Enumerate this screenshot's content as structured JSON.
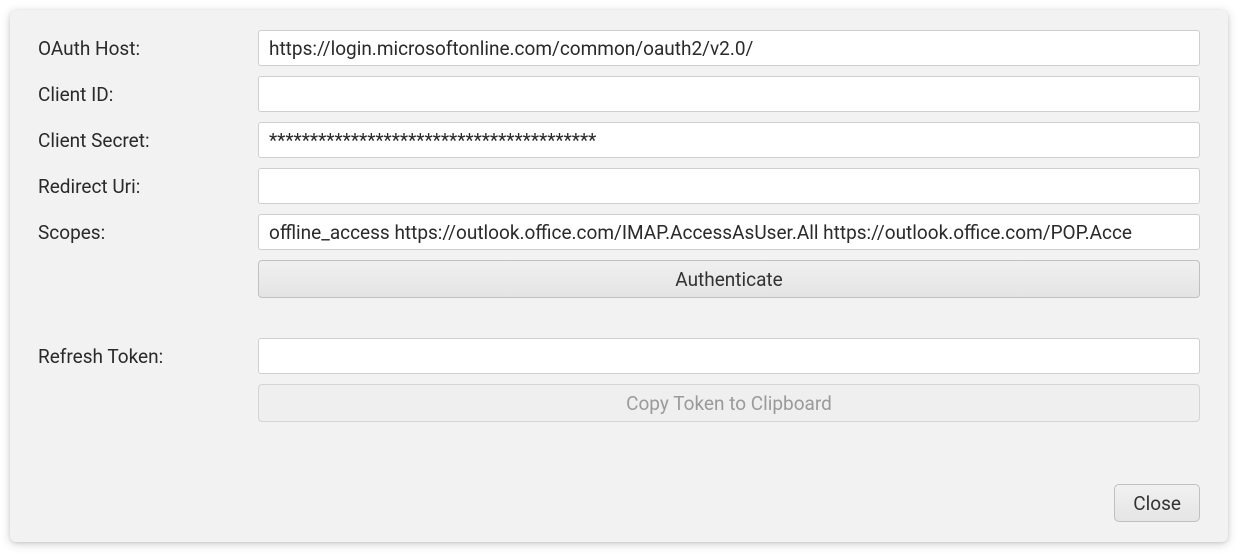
{
  "fields": {
    "oauth_host": {
      "label": "OAuth Host:",
      "value": "https://login.microsoftonline.com/common/oauth2/v2.0/"
    },
    "client_id": {
      "label": "Client ID:",
      "value": ""
    },
    "client_secret": {
      "label": "Client Secret:",
      "value": "****************************************"
    },
    "redirect_uri": {
      "label": "Redirect Uri:",
      "value": ""
    },
    "scopes": {
      "label": "Scopes:",
      "value": "offline_access https://outlook.office.com/IMAP.AccessAsUser.All https://outlook.office.com/POP.Acce"
    },
    "refresh_token": {
      "label": "Refresh Token:",
      "value": ""
    }
  },
  "buttons": {
    "authenticate": "Authenticate",
    "copy_token": "Copy Token to Clipboard",
    "close": "Close"
  }
}
